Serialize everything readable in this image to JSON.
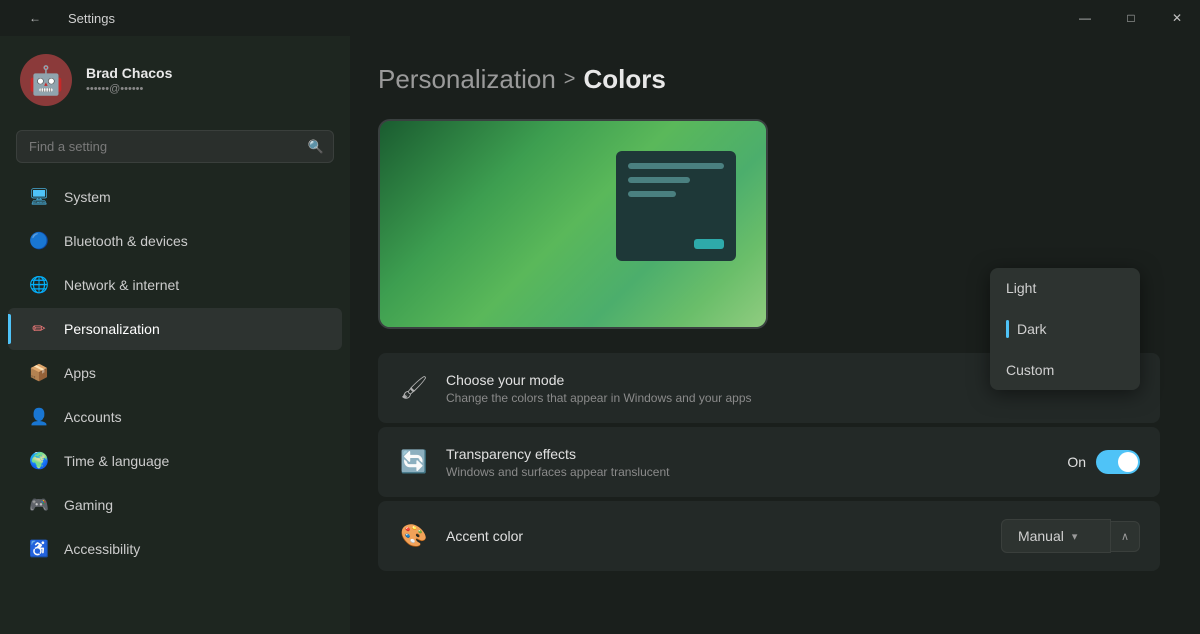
{
  "titlebar": {
    "title": "Settings",
    "back_icon": "←",
    "minimize": "—",
    "maximize": "□",
    "close": "✕"
  },
  "user": {
    "name": "Brad Chacos",
    "email": "••••••@••••••",
    "avatar_emoji": "🤖"
  },
  "search": {
    "placeholder": "Find a setting"
  },
  "nav": {
    "items": [
      {
        "id": "system",
        "label": "System",
        "icon": "🖥",
        "icon_class": "blue"
      },
      {
        "id": "bluetooth",
        "label": "Bluetooth & devices",
        "icon": "🔵",
        "icon_class": "bluetooth"
      },
      {
        "id": "network",
        "label": "Network & internet",
        "icon": "🌐",
        "icon_class": "network"
      },
      {
        "id": "personalization",
        "label": "Personalization",
        "icon": "✏",
        "icon_class": "personalization",
        "active": true
      },
      {
        "id": "apps",
        "label": "Apps",
        "icon": "📦",
        "icon_class": "apps"
      },
      {
        "id": "accounts",
        "label": "Accounts",
        "icon": "👤",
        "icon_class": "accounts"
      },
      {
        "id": "time",
        "label": "Time & language",
        "icon": "🌍",
        "icon_class": "time"
      },
      {
        "id": "gaming",
        "label": "Gaming",
        "icon": "🎮",
        "icon_class": "gaming"
      },
      {
        "id": "accessibility",
        "label": "Accessibility",
        "icon": "♿",
        "icon_class": "accessibility"
      }
    ]
  },
  "breadcrumb": {
    "parent": "Personalization",
    "separator": ">",
    "current": "Colors"
  },
  "settings": {
    "mode": {
      "title": "Choose your mode",
      "description": "Change the colors that appear in Windows and your apps",
      "icon": "🖌"
    },
    "mode_options": [
      {
        "label": "Light",
        "selected": false
      },
      {
        "label": "Dark",
        "selected": true
      },
      {
        "label": "Custom",
        "selected": false
      }
    ],
    "transparency": {
      "title": "Transparency effects",
      "description": "Windows and surfaces appear translucent",
      "icon": "🔄",
      "toggle_label": "On",
      "enabled": true
    },
    "accent": {
      "title": "Accent color",
      "icon": "🎨",
      "value": "Manual",
      "chevron_down": "▾",
      "chevron_up": "∧"
    }
  }
}
